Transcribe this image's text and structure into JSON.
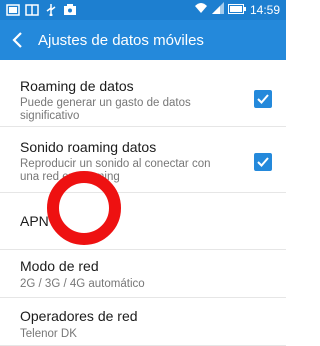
{
  "status_bar": {
    "time": "14:59",
    "icons_left": [
      "gallery-icon",
      "image-icon",
      "usb-icon",
      "photo-icon"
    ],
    "icons_right": [
      "wifi-icon",
      "signal-icon",
      "battery-icon"
    ]
  },
  "app_bar": {
    "title": "Ajustes de datos móviles",
    "back_icon": "chevron-left-icon"
  },
  "settings": [
    {
      "title": "Roaming de datos",
      "subtitle": "Puede generar un gasto de datos significativo",
      "checked": true
    },
    {
      "title": "Sonido roaming datos",
      "subtitle": "Reproducir un sonido al conectar con una red en roaming",
      "checked": true
    },
    {
      "title": "APN"
    },
    {
      "title": "Modo de red",
      "subtitle": "2G / 3G / 4G automático"
    },
    {
      "title": "Operadores de red",
      "subtitle": "Telenor DK"
    }
  ],
  "colors": {
    "status_bar": "#1d7fd0",
    "app_bar": "#2489db",
    "accent": "#2489db",
    "annotation_circle": "#ee1111"
  }
}
